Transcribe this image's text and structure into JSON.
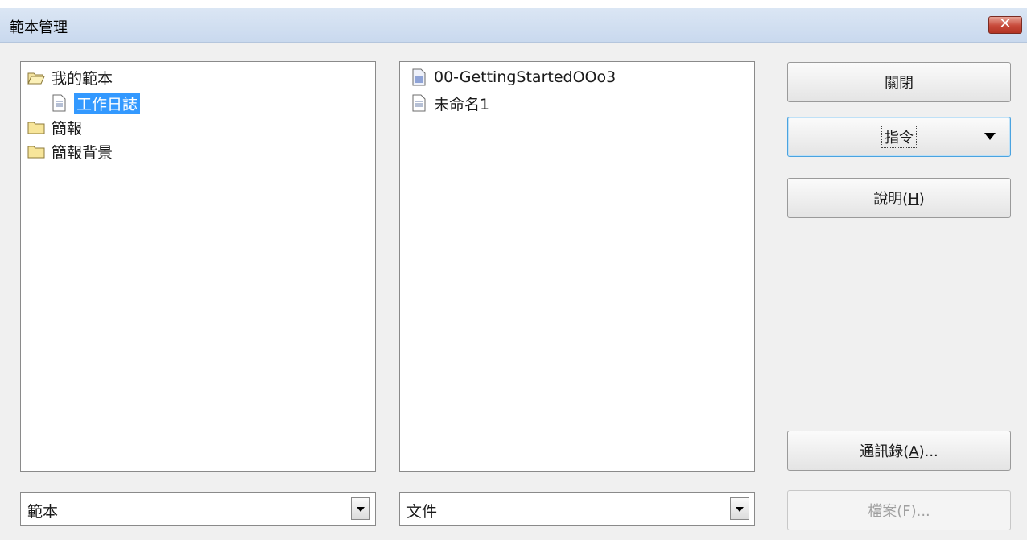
{
  "window": {
    "title": "範本管理",
    "close_symbol": "✕"
  },
  "left_panel": {
    "items": [
      {
        "label": "我的範本",
        "icon": "open-folder-icon",
        "expanded": true
      },
      {
        "label": "工作日誌",
        "icon": "document-icon",
        "selected": true
      },
      {
        "label": "簡報",
        "icon": "folder-icon"
      },
      {
        "label": "簡報背景",
        "icon": "folder-icon"
      }
    ]
  },
  "right_panel": {
    "items": [
      {
        "label": "00-GettingStartedOOo3",
        "icon": "document-icon"
      },
      {
        "label": "未命名1",
        "icon": "document-icon"
      }
    ]
  },
  "buttons": {
    "close": "關閉",
    "commands": "指令",
    "help_prefix": "說明(",
    "help_key": "H",
    "help_suffix": ")",
    "address_prefix": "通訊錄(",
    "address_key": "A",
    "address_suffix": ")...",
    "file_prefix": "檔案(",
    "file_key": "F",
    "file_suffix": ")..."
  },
  "left_combo": {
    "value": "範本"
  },
  "right_combo": {
    "value": "文件"
  },
  "colors": {
    "selection": "#3399ff",
    "titlebar": "#c9d9ee",
    "close_button": "#c7493a"
  }
}
